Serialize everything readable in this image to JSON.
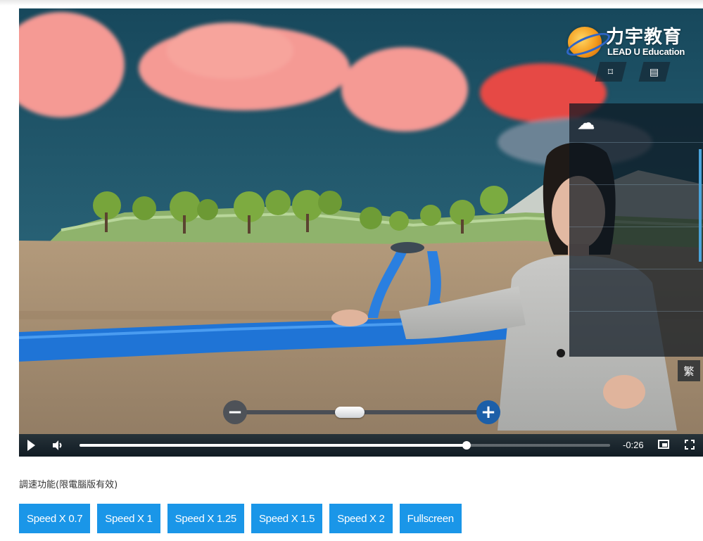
{
  "video": {
    "logo": {
      "chinese_name": "力宇教育",
      "english_name": "LEAD U Education"
    },
    "overlay": {
      "expand_icon": "expand-icon",
      "menu_icon": "menu-icon",
      "cloud_icon": "cloud-upload-icon",
      "traditional_chinese_label": "繁"
    },
    "zoom": {
      "minus_label": "−",
      "plus_label": "+",
      "level": 0.5
    },
    "controls": {
      "play_icon": "play-icon",
      "volume_icon": "volume-icon",
      "progress": 0.73,
      "time_remaining": "-0:26",
      "pip_icon": "picture-in-picture-icon",
      "fullscreen_icon": "fullscreen-icon"
    },
    "colors": {
      "background_sky": "#1f4f62",
      "river": "#1f74d6",
      "button_blue": "#1a96e8"
    }
  },
  "speed_section": {
    "note": "調速功能(限電腦版有效)",
    "buttons": [
      {
        "label": "Speed X 0.7"
      },
      {
        "label": "Speed X 1"
      },
      {
        "label": "Speed X 1.25"
      },
      {
        "label": "Speed X 1.5"
      },
      {
        "label": "Speed X 2"
      },
      {
        "label": "Fullscreen"
      }
    ]
  }
}
